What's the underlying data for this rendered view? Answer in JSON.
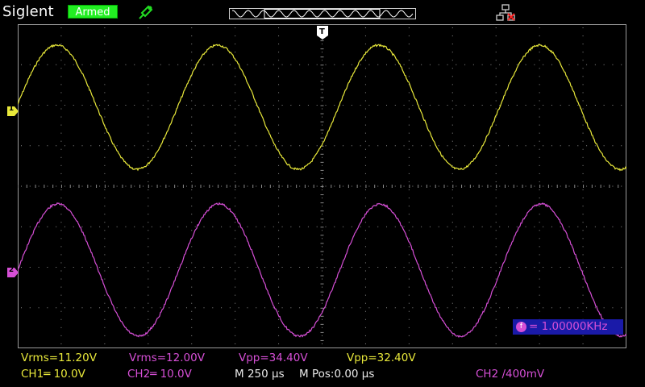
{
  "header": {
    "brand": "Siglent",
    "status": "Armed",
    "trigger_marker": "T"
  },
  "channels": {
    "ch1_marker": "1",
    "ch2_marker": "2"
  },
  "measurements": {
    "ch1_vrms": "Vrms=11.20V",
    "ch2_vrms": "Vrms=12.00V",
    "ch1_vpp": "Vpp=34.40V",
    "ch2_vpp": "Vpp=32.40V"
  },
  "bottom": {
    "ch1_scale": "CH1═ 10.0V",
    "ch2_scale": "CH2═ 10.0V",
    "timebase": "M 250 µs",
    "mpos": "M Pos:0.00 µs",
    "trigger": "CH2 ∕400mV"
  },
  "frequency": {
    "icon": "f",
    "value": "= 1.00000KHz"
  },
  "colors": {
    "ch1": "#e8e83a",
    "ch2": "#d64fd6",
    "grid": "#9a9a9a",
    "status_bg": "#22ee22",
    "freq_bg": "#1a1aa8"
  },
  "icons": {
    "probe": "probe-icon",
    "network": "network-icon",
    "trigger": "trigger-marker-icon"
  },
  "waveforms": {
    "frequency_hz": 1000,
    "periods_on_screen": 3.78
  }
}
